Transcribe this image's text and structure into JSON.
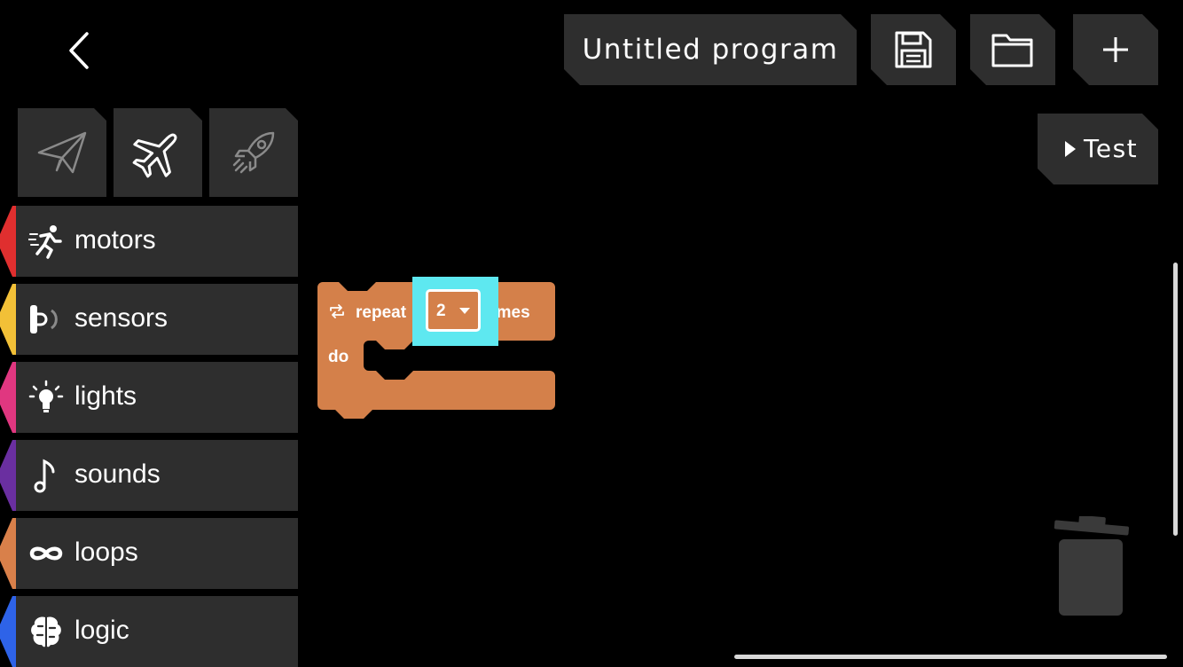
{
  "header": {
    "program_title": "Untitled program",
    "test_label": "Test"
  },
  "tabs": [
    {
      "name": "paper-plane",
      "active": false
    },
    {
      "name": "airplane",
      "active": true
    },
    {
      "name": "rocket",
      "active": false
    }
  ],
  "categories": [
    {
      "label": "motors",
      "color": "#e02f2f"
    },
    {
      "label": "sensors",
      "color": "#f2c037"
    },
    {
      "label": "lights",
      "color": "#e03780"
    },
    {
      "label": "sounds",
      "color": "#6a2fa0"
    },
    {
      "label": "loops",
      "color": "#d9804a"
    },
    {
      "label": "logic",
      "color": "#2e63e8"
    }
  ],
  "block": {
    "repeat_label": "repeat",
    "times_value": "2",
    "times_label": "times",
    "do_label": "do",
    "color": "#d4804a",
    "highlight": "#5ee8f0"
  }
}
